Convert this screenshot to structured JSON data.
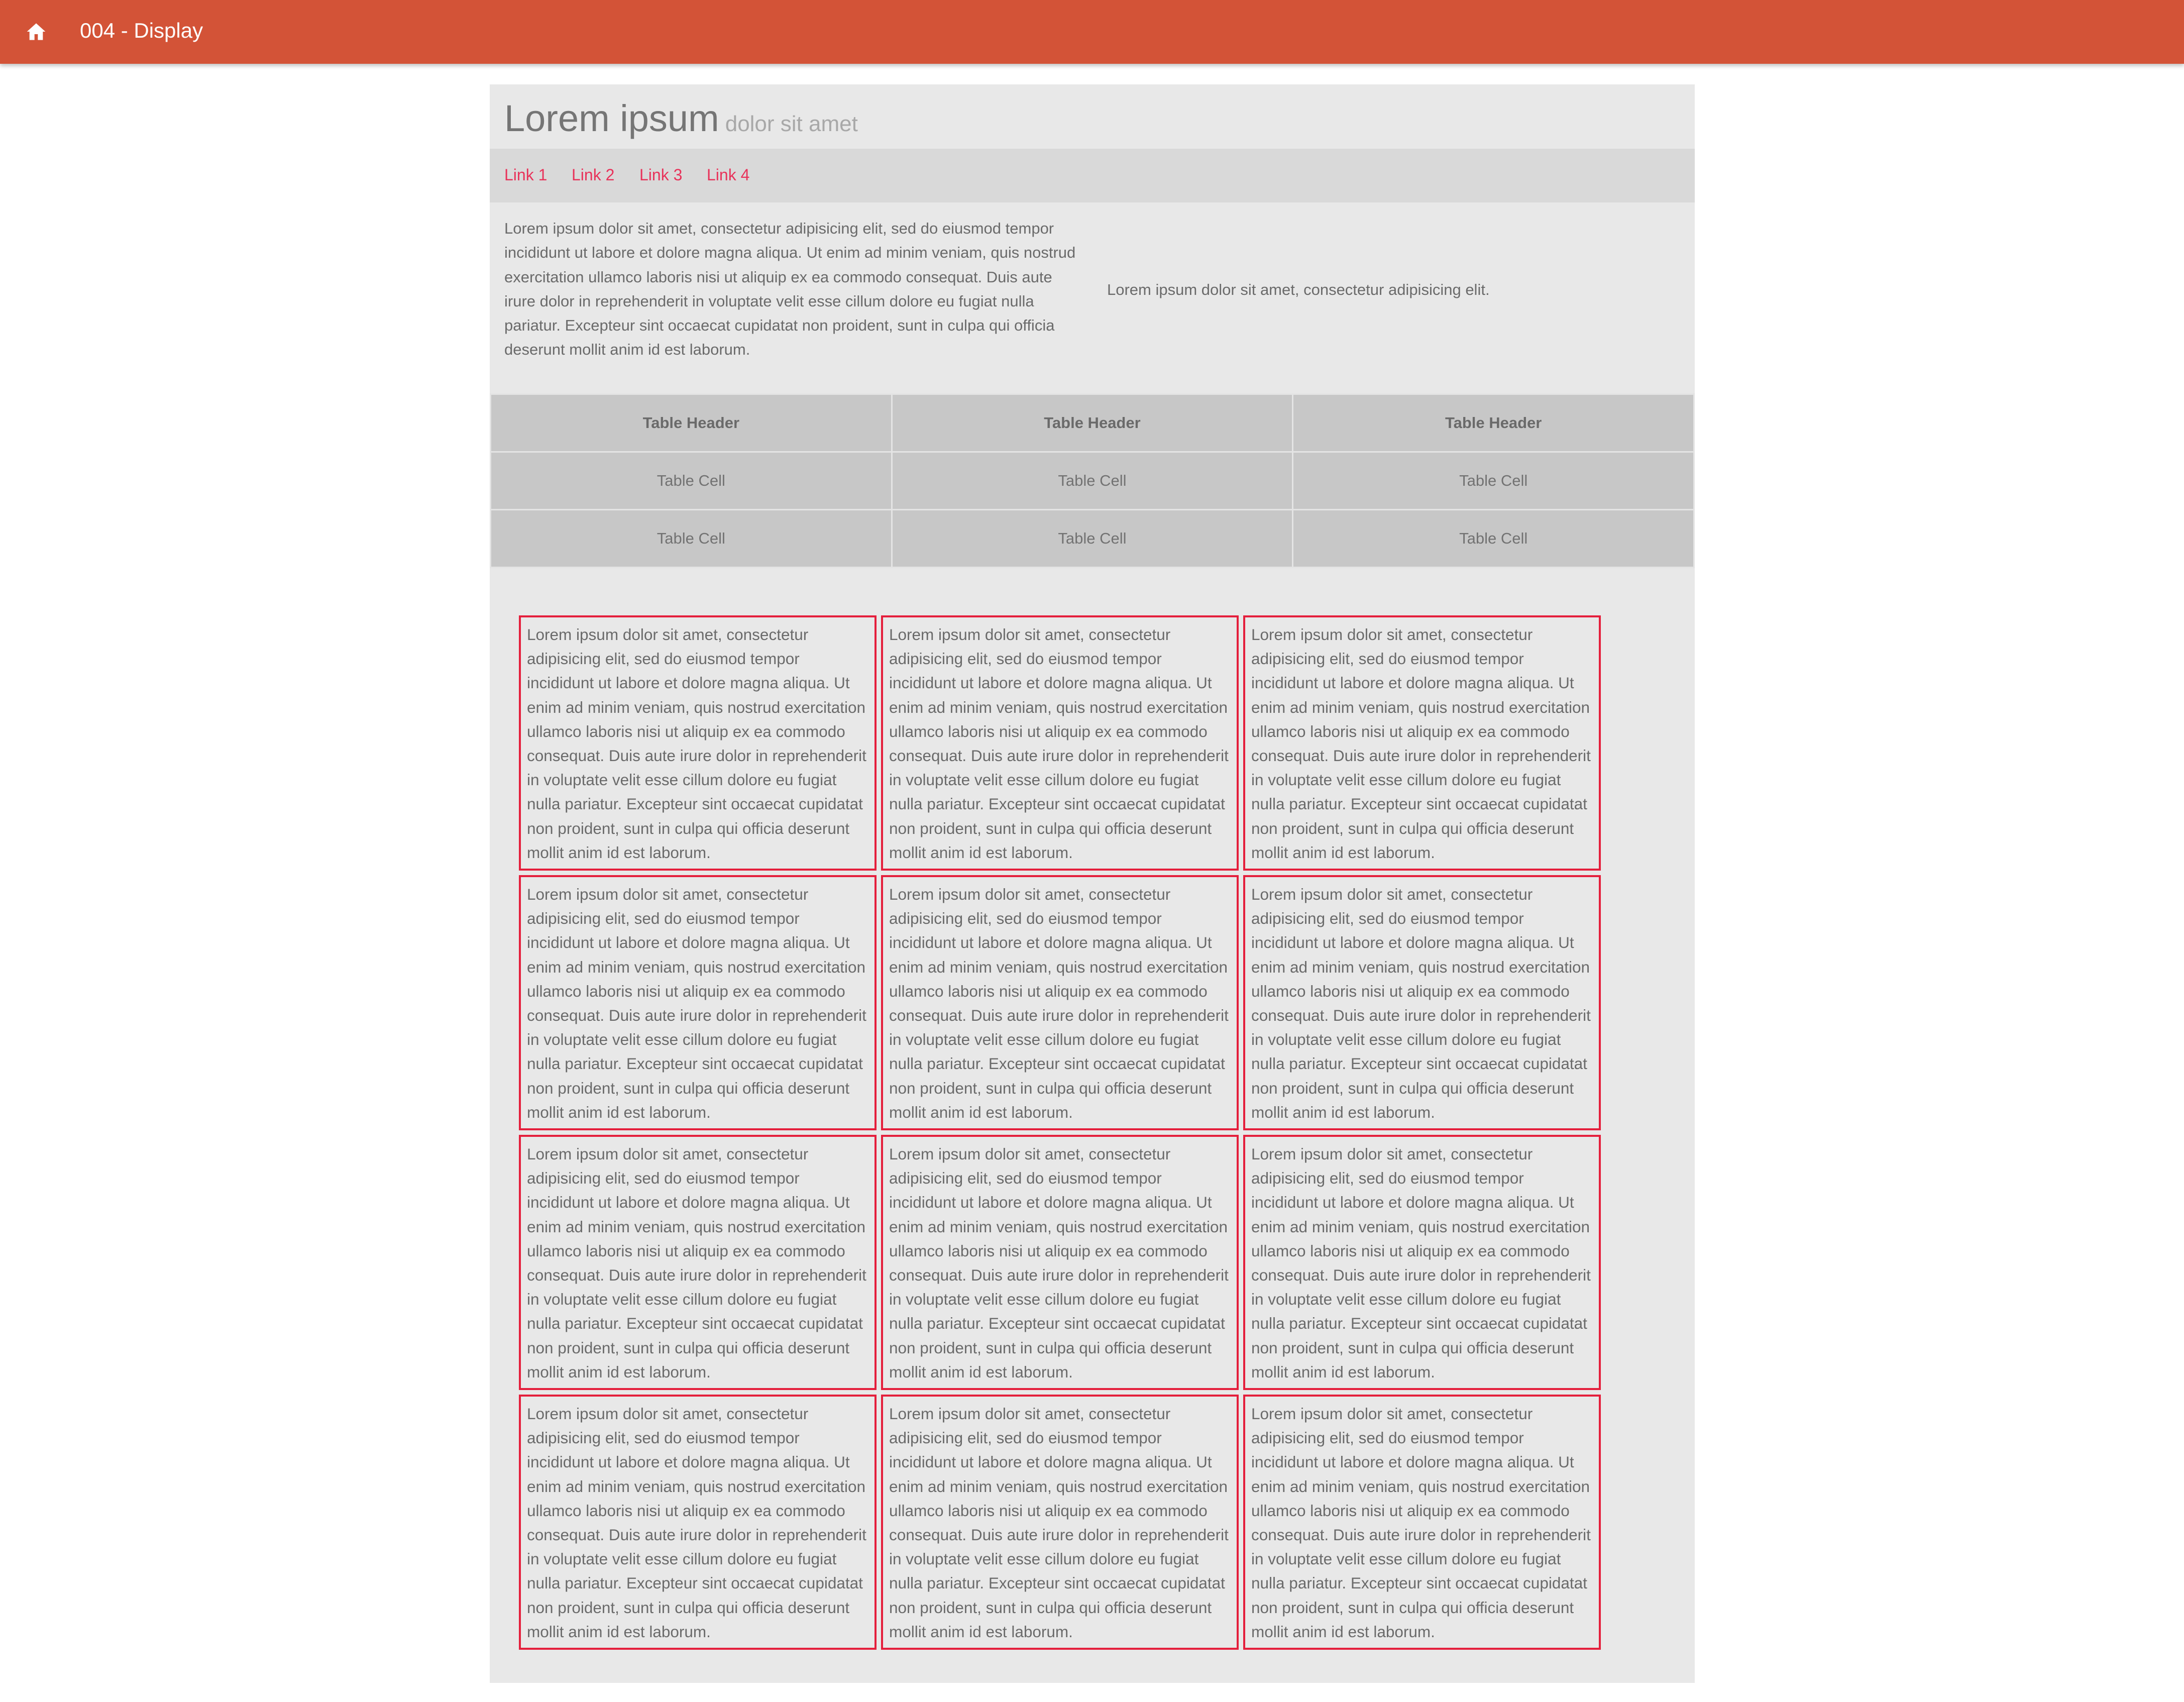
{
  "topbar": {
    "title": "004 - Display",
    "home_icon": "home-icon",
    "color": "#d35337"
  },
  "header": {
    "title": "Lorem ipsum",
    "subtitle": "dolor sit amet"
  },
  "nav": {
    "links": [
      "Link 1",
      "Link 2",
      "Link 3",
      "Link 4"
    ],
    "link_color": "#e8325a"
  },
  "intro": {
    "left": "Lorem ipsum dolor sit amet, consectetur adipisicing elit, sed do eiusmod tempor incididunt ut labore et dolore magna aliqua. Ut enim ad minim veniam, quis nostrud exercitation ullamco laboris nisi ut aliquip ex ea commodo consequat. Duis aute irure dolor in reprehenderit in voluptate velit esse cillum dolore eu fugiat nulla pariatur. Excepteur sint occaecat cupidatat non proident, sunt in culpa qui officia deserunt mollit anim id est laborum.",
    "right": "Lorem ipsum dolor sit amet, consectetur adipisicing elit."
  },
  "table": {
    "headers": [
      "Table Header",
      "Table Header",
      "Table Header"
    ],
    "rows": [
      [
        "Table Cell",
        "Table Cell",
        "Table Cell"
      ],
      [
        "Table Cell",
        "Table Cell",
        "Table Cell"
      ]
    ]
  },
  "cards": {
    "border_color": "#e41f3c",
    "items": [
      "Lorem ipsum dolor sit amet, consectetur adipisicing elit, sed do eiusmod tempor incididunt ut labore et dolore magna aliqua. Ut enim ad minim veniam, quis nostrud exercitation ullamco laboris nisi ut aliquip ex ea commodo consequat. Duis aute irure dolor in reprehenderit in voluptate velit esse cillum dolore eu fugiat nulla pariatur. Excepteur sint occaecat cupidatat non proident, sunt in culpa qui officia deserunt mollit anim id est laborum.",
      "Lorem ipsum dolor sit amet, consectetur adipisicing elit, sed do eiusmod tempor incididunt ut labore et dolore magna aliqua. Ut enim ad minim veniam, quis nostrud exercitation ullamco laboris nisi ut aliquip ex ea commodo consequat. Duis aute irure dolor in reprehenderit in voluptate velit esse cillum dolore eu fugiat nulla pariatur. Excepteur sint occaecat cupidatat non proident, sunt in culpa qui officia deserunt mollit anim id est laborum.",
      "Lorem ipsum dolor sit amet, consectetur adipisicing elit, sed do eiusmod tempor incididunt ut labore et dolore magna aliqua. Ut enim ad minim veniam, quis nostrud exercitation ullamco laboris nisi ut aliquip ex ea commodo consequat. Duis aute irure dolor in reprehenderit in voluptate velit esse cillum dolore eu fugiat nulla pariatur. Excepteur sint occaecat cupidatat non proident, sunt in culpa qui officia deserunt mollit anim id est laborum.",
      "Lorem ipsum dolor sit amet, consectetur adipisicing elit, sed do eiusmod tempor incididunt ut labore et dolore magna aliqua. Ut enim ad minim veniam, quis nostrud exercitation ullamco laboris nisi ut aliquip ex ea commodo consequat. Duis aute irure dolor in reprehenderit in voluptate velit esse cillum dolore eu fugiat nulla pariatur. Excepteur sint occaecat cupidatat non proident, sunt in culpa qui officia deserunt mollit anim id est laborum.",
      "Lorem ipsum dolor sit amet, consectetur adipisicing elit, sed do eiusmod tempor incididunt ut labore et dolore magna aliqua. Ut enim ad minim veniam, quis nostrud exercitation ullamco laboris nisi ut aliquip ex ea commodo consequat. Duis aute irure dolor in reprehenderit in voluptate velit esse cillum dolore eu fugiat nulla pariatur. Excepteur sint occaecat cupidatat non proident, sunt in culpa qui officia deserunt mollit anim id est laborum.",
      "Lorem ipsum dolor sit amet, consectetur adipisicing elit, sed do eiusmod tempor incididunt ut labore et dolore magna aliqua. Ut enim ad minim veniam, quis nostrud exercitation ullamco laboris nisi ut aliquip ex ea commodo consequat. Duis aute irure dolor in reprehenderit in voluptate velit esse cillum dolore eu fugiat nulla pariatur. Excepteur sint occaecat cupidatat non proident, sunt in culpa qui officia deserunt mollit anim id est laborum.",
      "Lorem ipsum dolor sit amet, consectetur adipisicing elit, sed do eiusmod tempor incididunt ut labore et dolore magna aliqua. Ut enim ad minim veniam, quis nostrud exercitation ullamco laboris nisi ut aliquip ex ea commodo consequat. Duis aute irure dolor in reprehenderit in voluptate velit esse cillum dolore eu fugiat nulla pariatur. Excepteur sint occaecat cupidatat non proident, sunt in culpa qui officia deserunt mollit anim id est laborum.",
      "Lorem ipsum dolor sit amet, consectetur adipisicing elit, sed do eiusmod tempor incididunt ut labore et dolore magna aliqua. Ut enim ad minim veniam, quis nostrud exercitation ullamco laboris nisi ut aliquip ex ea commodo consequat. Duis aute irure dolor in reprehenderit in voluptate velit esse cillum dolore eu fugiat nulla pariatur. Excepteur sint occaecat cupidatat non proident, sunt in culpa qui officia deserunt mollit anim id est laborum.",
      "Lorem ipsum dolor sit amet, consectetur adipisicing elit, sed do eiusmod tempor incididunt ut labore et dolore magna aliqua. Ut enim ad minim veniam, quis nostrud exercitation ullamco laboris nisi ut aliquip ex ea commodo consequat. Duis aute irure dolor in reprehenderit in voluptate velit esse cillum dolore eu fugiat nulla pariatur. Excepteur sint occaecat cupidatat non proident, sunt in culpa qui officia deserunt mollit anim id est laborum.",
      "Lorem ipsum dolor sit amet, consectetur adipisicing elit, sed do eiusmod tempor incididunt ut labore et dolore magna aliqua. Ut enim ad minim veniam, quis nostrud exercitation ullamco laboris nisi ut aliquip ex ea commodo consequat. Duis aute irure dolor in reprehenderit in voluptate velit esse cillum dolore eu fugiat nulla pariatur. Excepteur sint occaecat cupidatat non proident, sunt in culpa qui officia deserunt mollit anim id est laborum.",
      "Lorem ipsum dolor sit amet, consectetur adipisicing elit, sed do eiusmod tempor incididunt ut labore et dolore magna aliqua. Ut enim ad minim veniam, quis nostrud exercitation ullamco laboris nisi ut aliquip ex ea commodo consequat. Duis aute irure dolor in reprehenderit in voluptate velit esse cillum dolore eu fugiat nulla pariatur. Excepteur sint occaecat cupidatat non proident, sunt in culpa qui officia deserunt mollit anim id est laborum.",
      "Lorem ipsum dolor sit amet, consectetur adipisicing elit, sed do eiusmod tempor incididunt ut labore et dolore magna aliqua. Ut enim ad minim veniam, quis nostrud exercitation ullamco laboris nisi ut aliquip ex ea commodo consequat. Duis aute irure dolor in reprehenderit in voluptate velit esse cillum dolore eu fugiat nulla pariatur. Excepteur sint occaecat cupidatat non proident, sunt in culpa qui officia deserunt mollit anim id est laborum."
    ]
  }
}
